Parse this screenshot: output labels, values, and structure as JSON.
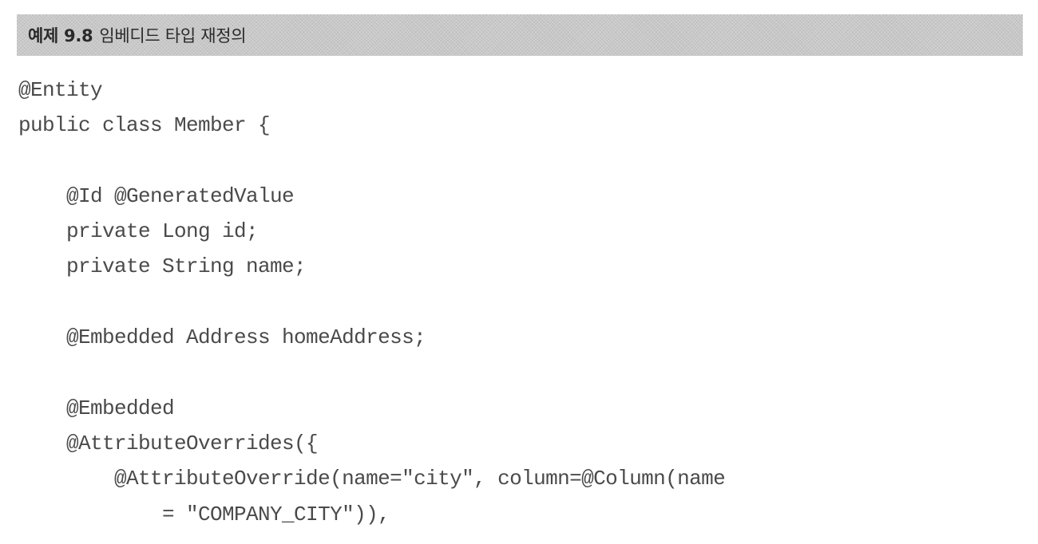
{
  "example": {
    "number": "예제 9.8",
    "title": "임베디드 타입 재정의"
  },
  "code": {
    "lines": [
      "@Entity",
      "public class Member {",
      "",
      "    @Id @GeneratedValue",
      "    private Long id;",
      "    private String name;",
      "",
      "    @Embedded Address homeAddress;",
      "",
      "    @Embedded",
      "    @AttributeOverrides({",
      "        @AttributeOverride(name=\"city\", column=@Column(name",
      "            = \"COMPANY_CITY\")),"
    ]
  }
}
